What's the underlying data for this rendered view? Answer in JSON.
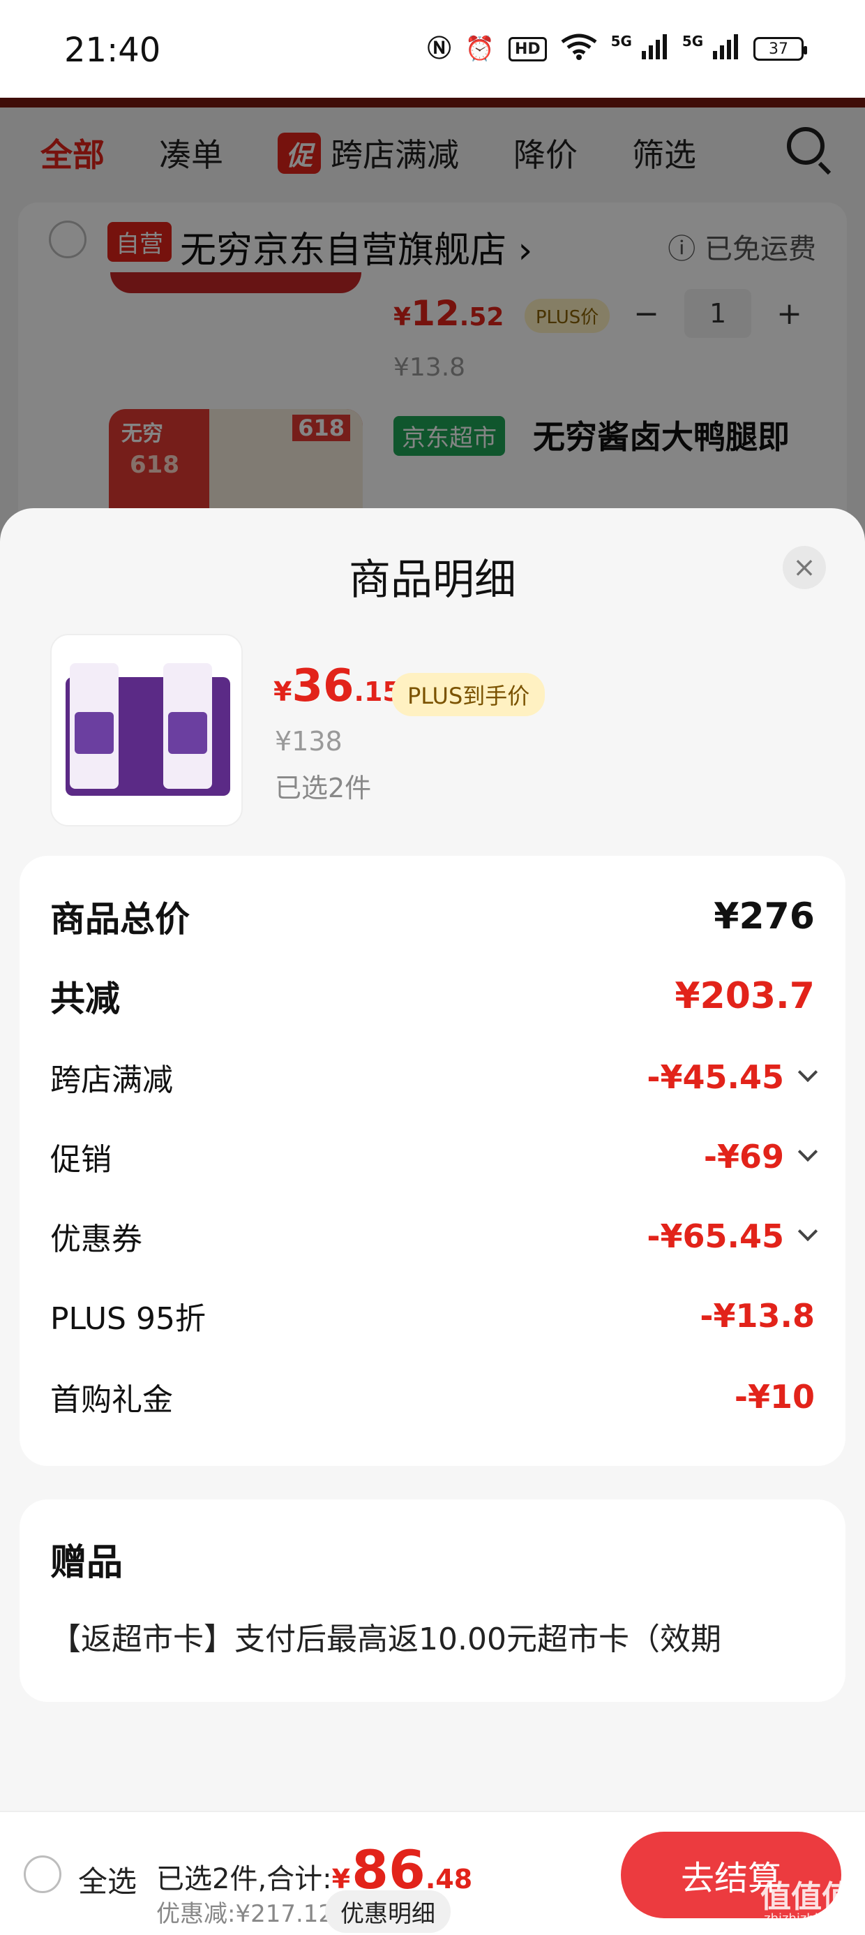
{
  "status_bar": {
    "time": "21:40",
    "icons": [
      "nfc-icon",
      "alarm-icon",
      "hd-icon",
      "wifi-icon",
      "signal-5g-icon",
      "signal-5g-icon"
    ],
    "hd_label": "HD",
    "net1": "5G",
    "net2": "5G",
    "battery": "37"
  },
  "background_page": {
    "filters": [
      "全部",
      "凑单",
      "跨店满减",
      "降价",
      "筛选"
    ],
    "promo_tag": "促",
    "shop": {
      "self_tag": "自营",
      "name": "无穷京东自营旗舰店",
      "shipping": "已免运费"
    },
    "item1": {
      "price_currency": "¥",
      "price_int": "12",
      "price_dec": ".52",
      "plus_label": "PLUS价",
      "orig_price": "¥13.8",
      "qty": "1",
      "minus": "−",
      "plus": "+"
    },
    "item2": {
      "tag": "京东超市",
      "title": "无穷酱卤大鸭腿即",
      "thumb_brand": "无穷",
      "thumb_618": "618",
      "thumb_anniv": "618"
    }
  },
  "sheet": {
    "title": "商品明细",
    "close_symbol": "×",
    "product": {
      "price_currency": "¥",
      "price_int": "36",
      "price_dec": ".15",
      "plus_label": "PLUS到手价",
      "orig_price": "¥138",
      "selected": "已选2件"
    },
    "breakdown": {
      "total_label": "商品总价",
      "total_value": "¥276",
      "reduce_label": "共减",
      "reduce_value": "¥203.7",
      "items": [
        {
          "label": "跨店满减",
          "value": "-¥45.45",
          "expand": true
        },
        {
          "label": "促销",
          "value": "-¥69",
          "expand": true
        },
        {
          "label": "优惠券",
          "value": "-¥65.45",
          "expand": true
        },
        {
          "label": "PLUS 95折",
          "value": "-¥13.8",
          "expand": false
        },
        {
          "label": "首购礼金",
          "value": "-¥10",
          "expand": false
        }
      ]
    },
    "gift": {
      "title": "赠品",
      "text": "【返超市卡】支付后最高返10.00元超市卡（效期"
    }
  },
  "footer": {
    "select_all": "全选",
    "total_prefix": "已选2件,合计:",
    "total_currency": "¥",
    "total_int": "86",
    "total_dec": ".48",
    "saved": "优惠减:¥217.12",
    "detail_button": "优惠明细",
    "checkout": "去结算"
  },
  "watermark": {
    "text": "值值值",
    "site": "zhizhizhi.com"
  },
  "colors": {
    "accent_red": "#e2231a",
    "plus_bg": "#fff1c2",
    "checkout_bg": "#ec3b3f",
    "jd_green": "#20a557"
  }
}
